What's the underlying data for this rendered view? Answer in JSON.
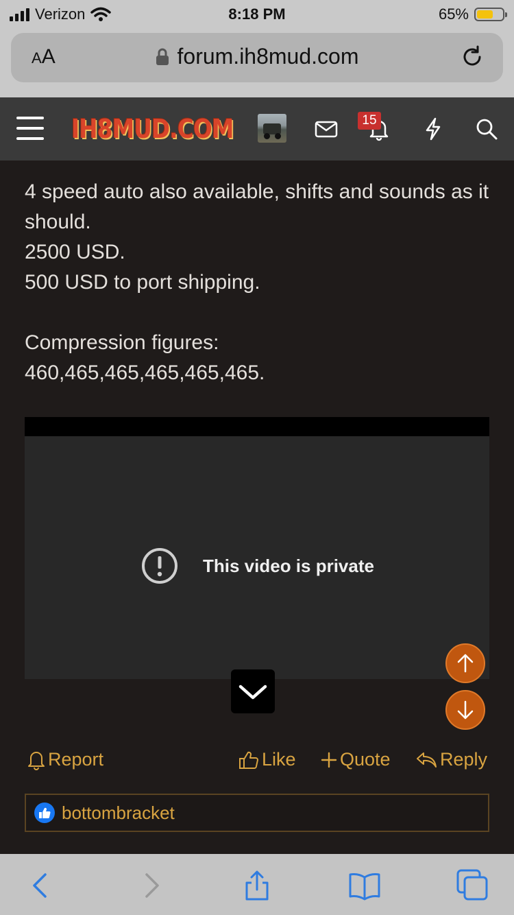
{
  "status_bar": {
    "carrier": "Verizon",
    "time": "8:18 PM",
    "battery_percent": "65%",
    "battery_level": 0.65,
    "icons": [
      "signal-icon",
      "wifi-icon",
      "battery-icon"
    ]
  },
  "browser": {
    "text_size_label_small": "A",
    "text_size_label_large": "A",
    "url": "forum.ih8mud.com",
    "icons": [
      "lock-icon",
      "reload-icon"
    ],
    "toolbar_icons": [
      "back-icon",
      "forward-icon",
      "share-icon",
      "bookmarks-icon",
      "tabs-icon"
    ]
  },
  "site_header": {
    "logo_text": "IH8MUD.COM",
    "notification_count": "15",
    "icons": [
      "menu-icon",
      "avatar",
      "mail-icon",
      "bell-icon",
      "lightning-icon",
      "search-icon"
    ]
  },
  "post": {
    "lines": [
      "4 speed auto also available, shifts and sounds as it should.",
      "2500 USD.",
      "500 USD to port shipping.",
      "",
      "Compression figures:",
      "460,465,465,465,465,465."
    ],
    "video_message": "This video is private",
    "actions": {
      "report": "Report",
      "like": "Like",
      "quote": "Quote",
      "reply": "Reply"
    },
    "reactions_user": "bottombracket"
  },
  "colors": {
    "accent": "#d9a441",
    "page_bg": "#1f1b1a",
    "header_bg": "#3a3a3a",
    "badge": "#c8302e",
    "float_button": "#c0570f",
    "ios_blue": "#2f7ce0"
  }
}
